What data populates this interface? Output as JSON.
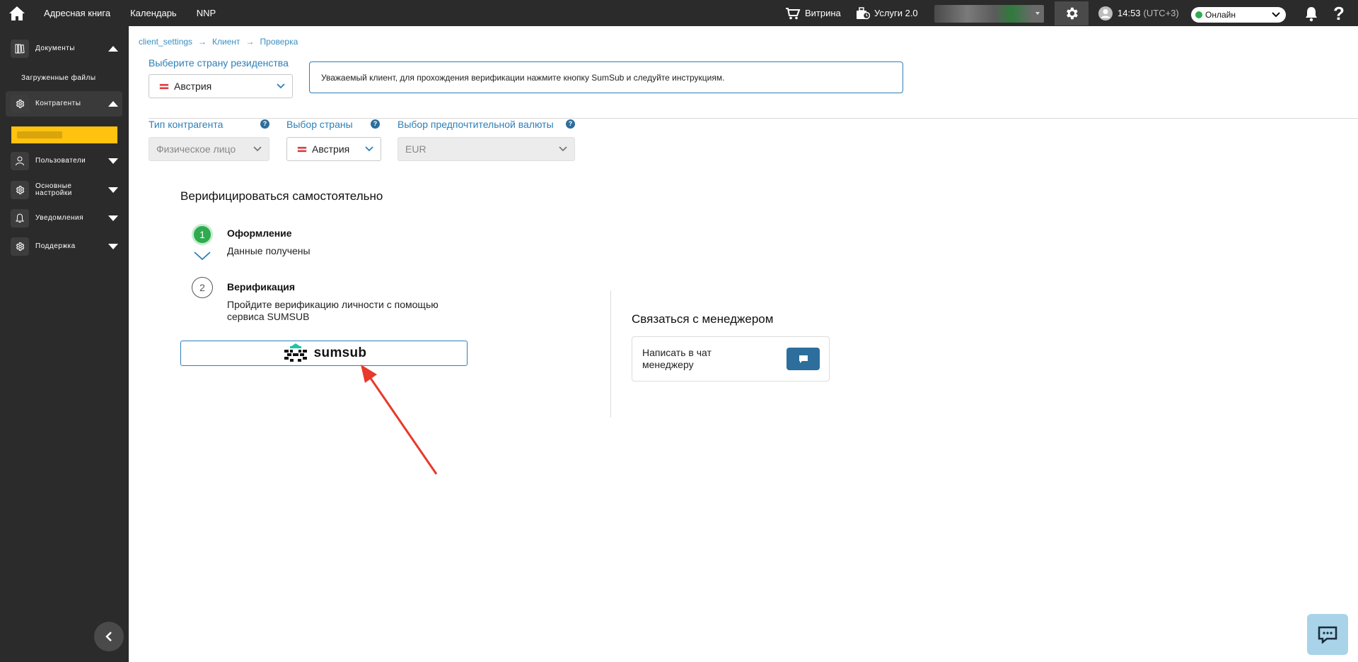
{
  "topbar": {
    "nav": [
      "Адресная книга",
      "Календарь",
      "NNP"
    ],
    "vitrina": "Витрина",
    "services": "Услуги 2.0",
    "time": "14:53",
    "timezone": "(UTC+3)",
    "status": "Онлайн",
    "help": "?"
  },
  "sidebar": {
    "documents": "Документы",
    "uploaded_files": "Загруженные файлы",
    "counterparties": "Контрагенты",
    "users": "Пользователи",
    "settings": "Основные настройки",
    "notifications": "Уведомления",
    "support": "Поддержка"
  },
  "breadcrumb": [
    "client_settings",
    "Клиент",
    "Проверка"
  ],
  "residence": {
    "label": "Выберите страну резиденства",
    "value": "Австрия"
  },
  "notice": "Уважаемый клиент, для прохождения верификации нажмите кнопку SumSub и следуйте инструкциям.",
  "fields": {
    "type_label": "Тип контрагента",
    "type_value": "Физическое лицо",
    "country_label": "Выбор страны",
    "country_value": "Австрия",
    "currency_label": "Выбор предпочтительной валюты",
    "currency_value": "EUR",
    "help": "?"
  },
  "verify": {
    "title": "Верифицироваться самостоятельно",
    "step1_num": "1",
    "step1_title": "Оформление",
    "step1_desc": "Данные получены",
    "step2_num": "2",
    "step2_title": "Верификация",
    "step2_desc_line1": "Пройдите верификацию личности с помощью",
    "step2_desc_line2": "сервиса SUMSUB",
    "sumsub_label": "sumsub"
  },
  "manager": {
    "title": "Связаться с менеджером",
    "line1": "Написать в чат",
    "line2": "менеджеру"
  },
  "colors": {
    "accent": "#2d7fb8",
    "success": "#2eab4e",
    "highlight": "#ffc20e",
    "arrow": "#e8392b"
  }
}
